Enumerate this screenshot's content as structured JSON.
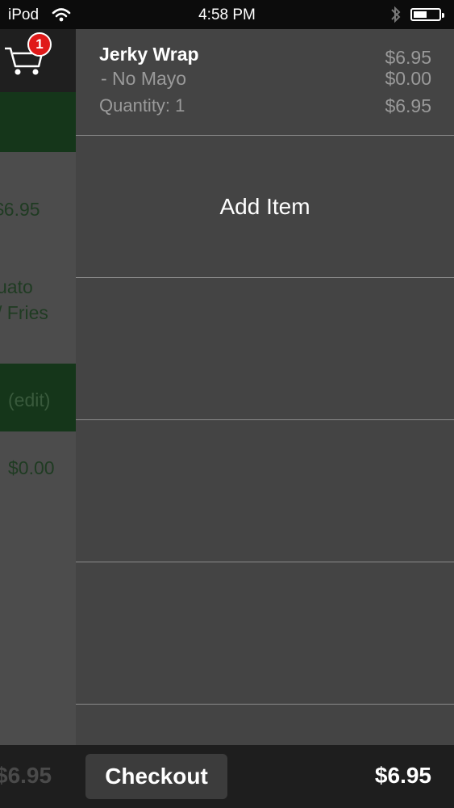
{
  "status_bar": {
    "carrier": "iPod",
    "time": "4:58 PM"
  },
  "left_panel": {
    "cart_badge": "1",
    "price": "$6.95",
    "desc_line1": "uato",
    "desc_line2": "/ Fries",
    "edit_label": "(edit)",
    "price_mod": "$0.00"
  },
  "cart": {
    "item": {
      "name": "Jerky Wrap",
      "price": "$6.95",
      "modifier": "- No Mayo",
      "modifier_price": "$0.00",
      "quantity_label": "Quantity: 1",
      "line_total": "$6.95"
    },
    "add_item_label": "Add Item"
  },
  "footer": {
    "left_total": "$6.95",
    "checkout_label": "Checkout",
    "grand_total": "$6.95"
  },
  "colors": {
    "accent_green": "#15361a",
    "badge_red": "#e01919"
  }
}
